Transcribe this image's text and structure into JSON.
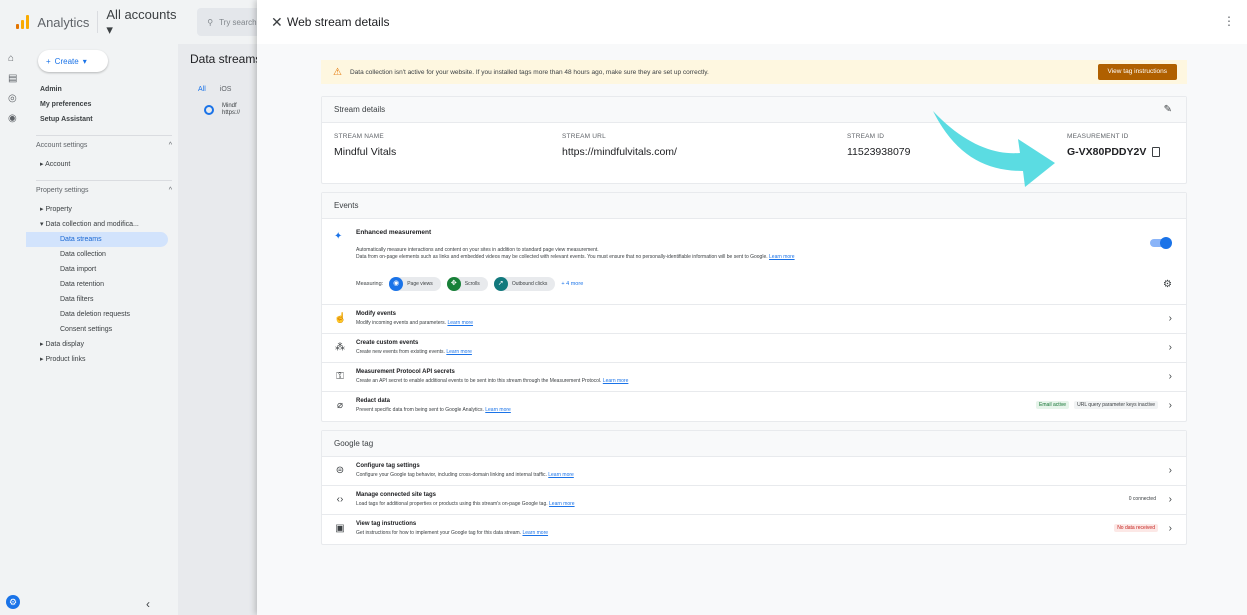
{
  "topbar": {
    "app_name": "Analytics",
    "accounts": "All accounts ▾",
    "search_placeholder": "Try search"
  },
  "leftnav": {
    "create_label": "Create",
    "items_top": [
      "Admin",
      "My preferences",
      "Setup Assistant"
    ],
    "account_settings_header": "Account settings",
    "account_item": "Account",
    "property_settings_header": "Property settings",
    "property_item": "Property",
    "data_collection_item": "Data collection and modifica...",
    "sub_items": [
      "Data streams",
      "Data collection",
      "Data import",
      "Data retention",
      "Data filters",
      "Data deletion requests",
      "Consent settings"
    ],
    "data_display_item": "Data display",
    "product_links_item": "Product links"
  },
  "midpanel": {
    "title": "Data streams",
    "tabs": [
      "All",
      "iOS"
    ],
    "stream_name": "Mindf",
    "stream_url": "https://"
  },
  "panel": {
    "title": "Web stream details"
  },
  "banner": {
    "text": "Data collection isn't active for your website. If you installed tags more than 48 hours ago, make sure they are set up correctly.",
    "button": "View tag instructions"
  },
  "stream_details": {
    "heading": "Stream details",
    "name_label": "STREAM NAME",
    "name_value": "Mindful Vitals",
    "url_label": "STREAM URL",
    "url_value": "https://mindfulvitals.com/",
    "id_label": "STREAM ID",
    "id_value": "11523938079",
    "mid_label": "MEASUREMENT ID",
    "mid_value": "G-VX80PDDY2V"
  },
  "events": {
    "heading": "Events",
    "em_title": "Enhanced measurement",
    "em_desc1": "Automatically measure interactions and content on your sites in addition to standard page view measurement.",
    "em_desc2": "Data from on-page elements such as links and embedded videos may be collected with relevant events. You must ensure that no personally-identifiable information will be sent to Google.",
    "learn_more": "Learn more",
    "measuring_label": "Measuring:",
    "chips": [
      "Page views",
      "Scrolls",
      "Outbound clicks"
    ],
    "more": "+ 4 more",
    "rows": [
      {
        "title": "Modify events",
        "desc": "Modify incoming events and parameters."
      },
      {
        "title": "Create custom events",
        "desc": "Create new events from existing events."
      },
      {
        "title": "Measurement Protocol API secrets",
        "desc": "Create an API secret to enable additional events to be sent into this stream through the Measurement Protocol."
      },
      {
        "title": "Redact data",
        "desc": "Prevent specific data from being sent to Google Analytics."
      }
    ],
    "redact_badge1": "Email active",
    "redact_badge2": "URL query parameter keys inactive"
  },
  "google_tag": {
    "heading": "Google tag",
    "rows": [
      {
        "title": "Configure tag settings",
        "desc": "Configure your Google tag behavior, including cross-domain linking and internal traffic."
      },
      {
        "title": "Manage connected site tags",
        "desc": "Load tags for additional properties or products using this stream's on-page Google tag."
      },
      {
        "title": "View tag instructions",
        "desc": "Get instructions for how to implement your Google tag for this data stream."
      }
    ],
    "connected_status": "0 connected",
    "no_data_badge": "No data received"
  },
  "colors": {
    "accent": "#1a73e8",
    "banner_bg": "#fef7e0",
    "banner_btn": "#b06000",
    "arrow": "#4dd9e0"
  }
}
